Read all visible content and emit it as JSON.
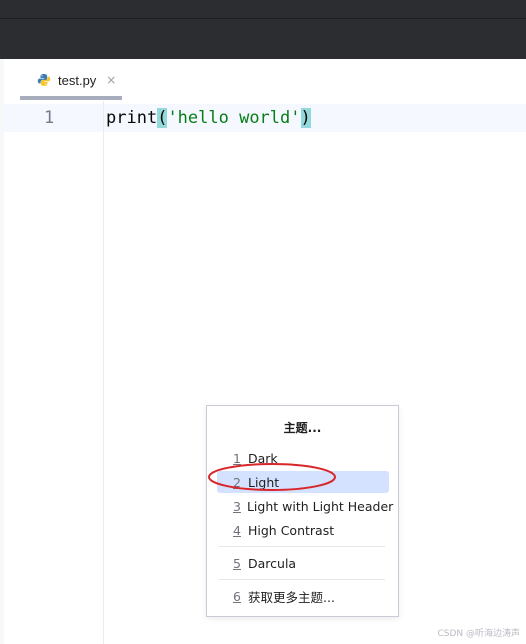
{
  "tabs": [
    {
      "label": "test.py",
      "close_glyph": "×",
      "icon": "python-file-icon",
      "active": true
    }
  ],
  "editor": {
    "line_numbers": [
      "1"
    ],
    "code": {
      "fn": "print",
      "open_paren": "(",
      "string": "'hello world'",
      "close_paren": ")"
    }
  },
  "theme_popup": {
    "title": "主题...",
    "items": [
      {
        "num": "1",
        "label": "Dark",
        "selected": false
      },
      {
        "num": "2",
        "label": "Light",
        "selected": true
      },
      {
        "num": "3",
        "label": "Light with Light Header",
        "selected": false
      },
      {
        "num": "4",
        "label": "High Contrast",
        "selected": false
      },
      {
        "num": "5",
        "label": "Darcula",
        "selected": false
      },
      {
        "num": "6",
        "label": "获取更多主题...",
        "selected": false
      }
    ]
  },
  "watermark": "CSDN @听海边涛声",
  "colors": {
    "toolbar": "#2b2d30",
    "selection": "#d4e2ff",
    "paren_highlight": "#93d9d9",
    "string": "#067d17",
    "annotation_circle": "#d9262b"
  }
}
